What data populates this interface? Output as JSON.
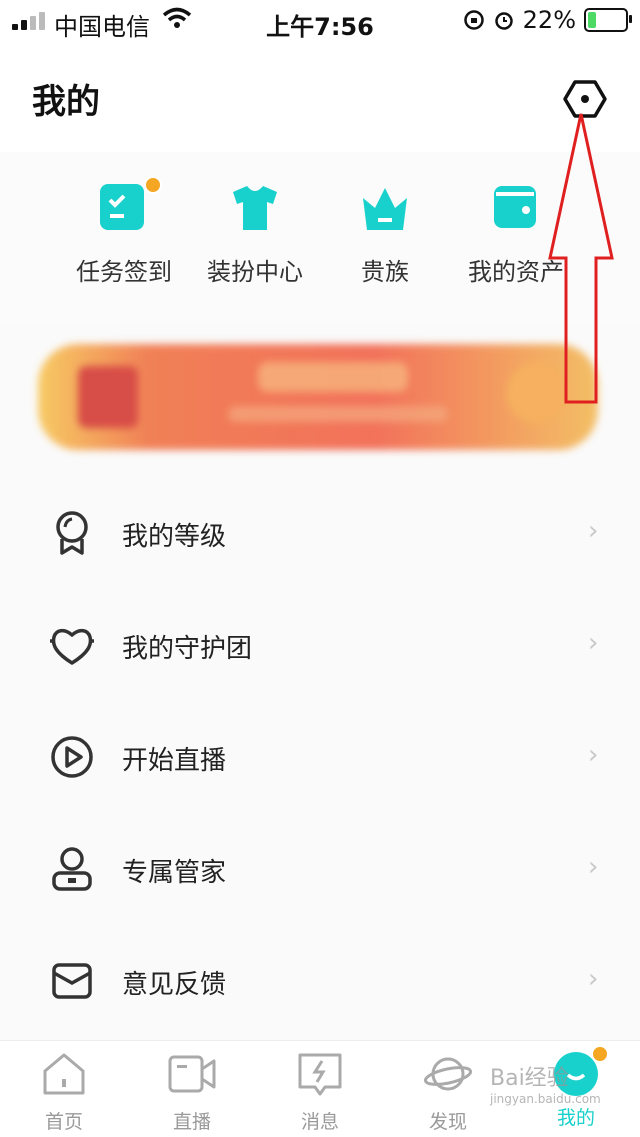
{
  "status_bar": {
    "carrier": "中国电信",
    "time": "上午7:56",
    "battery_percent": "22%",
    "battery_level": 0.22
  },
  "header": {
    "title": "我的"
  },
  "quick_actions": [
    {
      "label": "任务签到",
      "icon": "task-checkin-icon",
      "badge": true
    },
    {
      "label": "装扮中心",
      "icon": "tshirt-icon",
      "badge": false
    },
    {
      "label": "贵族",
      "icon": "crown-icon",
      "badge": false
    },
    {
      "label": "我的资产",
      "icon": "wallet-icon",
      "badge": false
    }
  ],
  "menu": [
    {
      "label": "我的等级",
      "icon": "medal-icon"
    },
    {
      "label": "我的守护团",
      "icon": "heart-shield-icon"
    },
    {
      "label": "开始直播",
      "icon": "play-circle-icon"
    },
    {
      "label": "专属管家",
      "icon": "butler-icon"
    },
    {
      "label": "意见反馈",
      "icon": "feedback-mail-icon"
    }
  ],
  "tabbar": [
    {
      "label": "首页",
      "icon": "home-icon"
    },
    {
      "label": "直播",
      "icon": "video-camera-icon"
    },
    {
      "label": "消息",
      "icon": "message-icon"
    },
    {
      "label": "发现",
      "icon": "planet-icon"
    },
    {
      "label": "我的",
      "icon": "profile-face-icon",
      "active": true
    }
  ],
  "watermark": {
    "text": "Bai经验",
    "sub": "jingyan.baidu.com"
  },
  "colors": {
    "accent": "#19d1cc",
    "badge": "#f5a623",
    "annotation": "#e02020"
  }
}
